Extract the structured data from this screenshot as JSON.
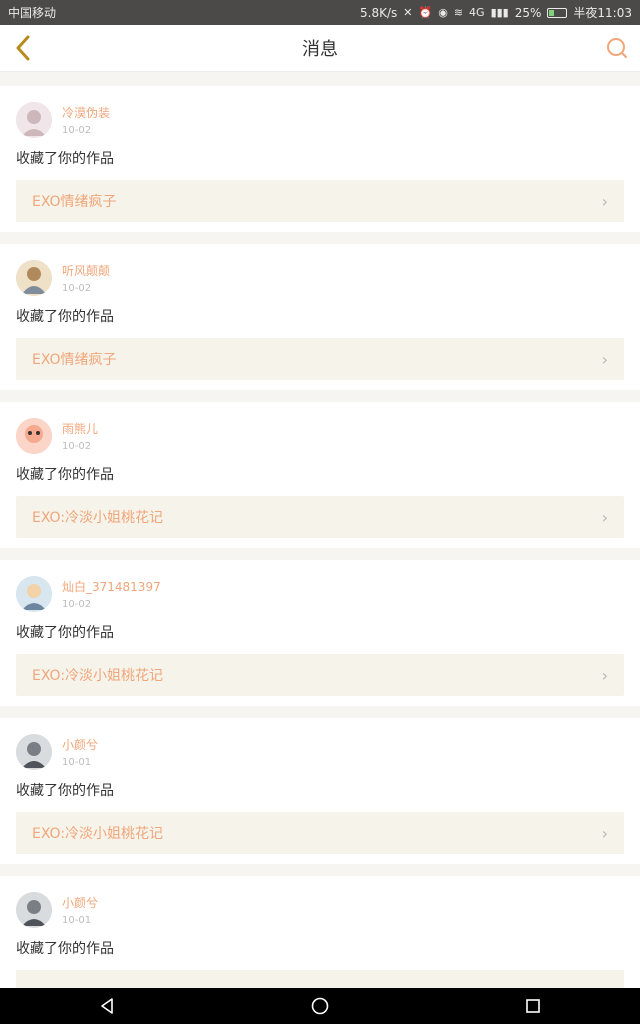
{
  "status": {
    "carrier": "中国移动",
    "speed": "5.8K/s",
    "network": "4G",
    "battery": "25%",
    "time": "半夜11:03"
  },
  "header": {
    "title": "消息"
  },
  "messages": [
    {
      "username": "冷漠伪装",
      "date": "10-02",
      "text": "收藏了你的作品",
      "work_title": "EXO情绪疯子"
    },
    {
      "username": "听风颠颠",
      "date": "10-02",
      "text": "收藏了你的作品",
      "work_title": "EXO情绪疯子"
    },
    {
      "username": "雨熊儿",
      "date": "10-02",
      "text": "收藏了你的作品",
      "work_title": "EXO:冷淡小姐桃花记"
    },
    {
      "username": "灿白_371481397",
      "date": "10-02",
      "text": "收藏了你的作品",
      "work_title": "EXO:冷淡小姐桃花记"
    },
    {
      "username": "小颜兮",
      "date": "10-01",
      "text": "收藏了你的作品",
      "work_title": "EXO:冷淡小姐桃花记"
    },
    {
      "username": "小颜兮",
      "date": "10-01",
      "text": "收藏了你的作品",
      "work_title": ""
    }
  ],
  "colors": {
    "accent": "#f0a67a",
    "card_bg": "#ffffff",
    "work_bg": "#f6f3ea"
  }
}
